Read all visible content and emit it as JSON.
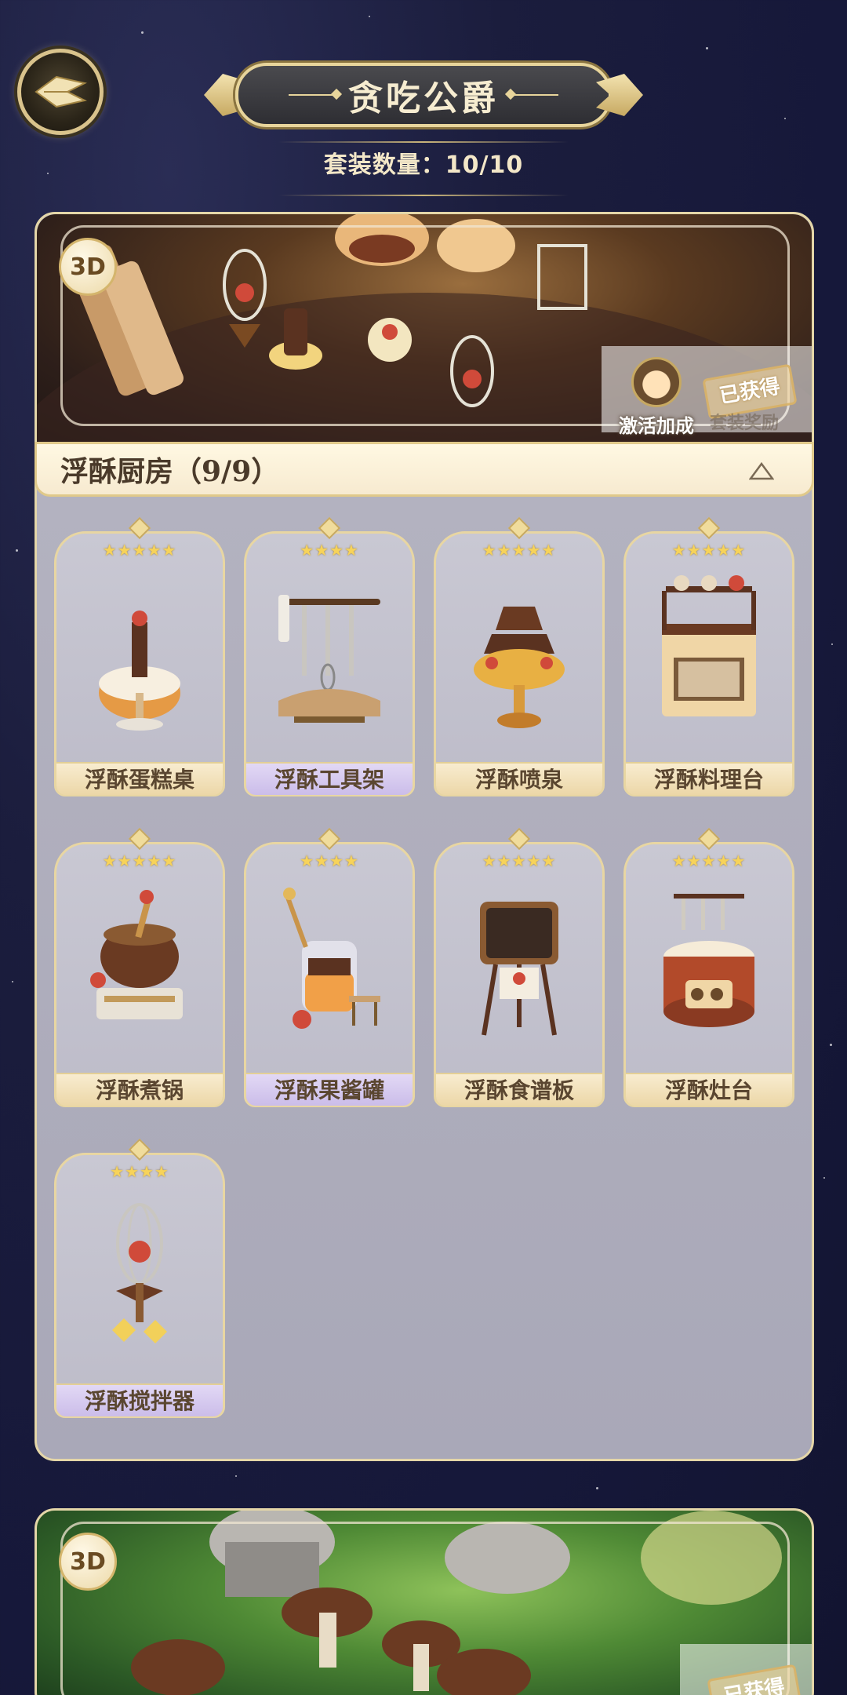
{
  "header": {
    "title": "贪吃公爵",
    "set_count": "套装数量：10/10"
  },
  "sets": [
    {
      "badge": "3D",
      "activate_label": "激活加成",
      "obtained": "已获得",
      "reward_label": "套装奖励",
      "name": "浮酥厨房（9/9）",
      "items": [
        {
          "name": "浮酥蛋糕桌",
          "stars": "★★★★★",
          "rarity": 5,
          "art": "cake-table"
        },
        {
          "name": "浮酥工具架",
          "stars": "★★★★",
          "rarity": 4,
          "art": "tool-rack"
        },
        {
          "name": "浮酥喷泉",
          "stars": "★★★★★",
          "rarity": 5,
          "art": "chocolate-fountain"
        },
        {
          "name": "浮酥料理台",
          "stars": "★★★★★",
          "rarity": 5,
          "art": "cooking-counter"
        },
        {
          "name": "浮酥煮锅",
          "stars": "★★★★★",
          "rarity": 5,
          "art": "cooking-pot"
        },
        {
          "name": "浮酥果酱罐",
          "stars": "★★★★",
          "rarity": 4,
          "art": "jam-jar"
        },
        {
          "name": "浮酥食谱板",
          "stars": "★★★★★",
          "rarity": 5,
          "art": "recipe-board"
        },
        {
          "name": "浮酥灶台",
          "stars": "★★★★★",
          "rarity": 5,
          "art": "stove"
        },
        {
          "name": "浮酥搅拌器",
          "stars": "★★★★",
          "rarity": 4,
          "art": "whisk"
        }
      ]
    },
    {
      "badge": "3D",
      "obtained": "已获得"
    }
  ],
  "colors": {
    "gold": "#e8d6a2",
    "five_star_name_bg": "#f3e3bc",
    "four_star_name_bg": "#d8ccf0",
    "background": "#1b1d3d"
  }
}
